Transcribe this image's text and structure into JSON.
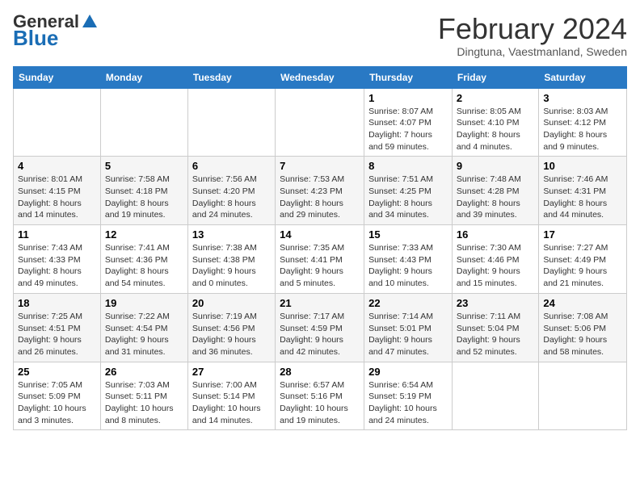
{
  "header": {
    "logo_general": "General",
    "logo_blue": "Blue",
    "title": "February 2024",
    "subtitle": "Dingtuna, Vaestmanland, Sweden"
  },
  "days": [
    "Sunday",
    "Monday",
    "Tuesday",
    "Wednesday",
    "Thursday",
    "Friday",
    "Saturday"
  ],
  "weeks": [
    [
      {
        "date": "",
        "text": ""
      },
      {
        "date": "",
        "text": ""
      },
      {
        "date": "",
        "text": ""
      },
      {
        "date": "",
        "text": ""
      },
      {
        "date": "1",
        "text": "Sunrise: 8:07 AM\nSunset: 4:07 PM\nDaylight: 7 hours\nand 59 minutes."
      },
      {
        "date": "2",
        "text": "Sunrise: 8:05 AM\nSunset: 4:10 PM\nDaylight: 8 hours\nand 4 minutes."
      },
      {
        "date": "3",
        "text": "Sunrise: 8:03 AM\nSunset: 4:12 PM\nDaylight: 8 hours\nand 9 minutes."
      }
    ],
    [
      {
        "date": "4",
        "text": "Sunrise: 8:01 AM\nSunset: 4:15 PM\nDaylight: 8 hours\nand 14 minutes."
      },
      {
        "date": "5",
        "text": "Sunrise: 7:58 AM\nSunset: 4:18 PM\nDaylight: 8 hours\nand 19 minutes."
      },
      {
        "date": "6",
        "text": "Sunrise: 7:56 AM\nSunset: 4:20 PM\nDaylight: 8 hours\nand 24 minutes."
      },
      {
        "date": "7",
        "text": "Sunrise: 7:53 AM\nSunset: 4:23 PM\nDaylight: 8 hours\nand 29 minutes."
      },
      {
        "date": "8",
        "text": "Sunrise: 7:51 AM\nSunset: 4:25 PM\nDaylight: 8 hours\nand 34 minutes."
      },
      {
        "date": "9",
        "text": "Sunrise: 7:48 AM\nSunset: 4:28 PM\nDaylight: 8 hours\nand 39 minutes."
      },
      {
        "date": "10",
        "text": "Sunrise: 7:46 AM\nSunset: 4:31 PM\nDaylight: 8 hours\nand 44 minutes."
      }
    ],
    [
      {
        "date": "11",
        "text": "Sunrise: 7:43 AM\nSunset: 4:33 PM\nDaylight: 8 hours\nand 49 minutes."
      },
      {
        "date": "12",
        "text": "Sunrise: 7:41 AM\nSunset: 4:36 PM\nDaylight: 8 hours\nand 54 minutes."
      },
      {
        "date": "13",
        "text": "Sunrise: 7:38 AM\nSunset: 4:38 PM\nDaylight: 9 hours\nand 0 minutes."
      },
      {
        "date": "14",
        "text": "Sunrise: 7:35 AM\nSunset: 4:41 PM\nDaylight: 9 hours\nand 5 minutes."
      },
      {
        "date": "15",
        "text": "Sunrise: 7:33 AM\nSunset: 4:43 PM\nDaylight: 9 hours\nand 10 minutes."
      },
      {
        "date": "16",
        "text": "Sunrise: 7:30 AM\nSunset: 4:46 PM\nDaylight: 9 hours\nand 15 minutes."
      },
      {
        "date": "17",
        "text": "Sunrise: 7:27 AM\nSunset: 4:49 PM\nDaylight: 9 hours\nand 21 minutes."
      }
    ],
    [
      {
        "date": "18",
        "text": "Sunrise: 7:25 AM\nSunset: 4:51 PM\nDaylight: 9 hours\nand 26 minutes."
      },
      {
        "date": "19",
        "text": "Sunrise: 7:22 AM\nSunset: 4:54 PM\nDaylight: 9 hours\nand 31 minutes."
      },
      {
        "date": "20",
        "text": "Sunrise: 7:19 AM\nSunset: 4:56 PM\nDaylight: 9 hours\nand 36 minutes."
      },
      {
        "date": "21",
        "text": "Sunrise: 7:17 AM\nSunset: 4:59 PM\nDaylight: 9 hours\nand 42 minutes."
      },
      {
        "date": "22",
        "text": "Sunrise: 7:14 AM\nSunset: 5:01 PM\nDaylight: 9 hours\nand 47 minutes."
      },
      {
        "date": "23",
        "text": "Sunrise: 7:11 AM\nSunset: 5:04 PM\nDaylight: 9 hours\nand 52 minutes."
      },
      {
        "date": "24",
        "text": "Sunrise: 7:08 AM\nSunset: 5:06 PM\nDaylight: 9 hours\nand 58 minutes."
      }
    ],
    [
      {
        "date": "25",
        "text": "Sunrise: 7:05 AM\nSunset: 5:09 PM\nDaylight: 10 hours\nand 3 minutes."
      },
      {
        "date": "26",
        "text": "Sunrise: 7:03 AM\nSunset: 5:11 PM\nDaylight: 10 hours\nand 8 minutes."
      },
      {
        "date": "27",
        "text": "Sunrise: 7:00 AM\nSunset: 5:14 PM\nDaylight: 10 hours\nand 14 minutes."
      },
      {
        "date": "28",
        "text": "Sunrise: 6:57 AM\nSunset: 5:16 PM\nDaylight: 10 hours\nand 19 minutes."
      },
      {
        "date": "29",
        "text": "Sunrise: 6:54 AM\nSunset: 5:19 PM\nDaylight: 10 hours\nand 24 minutes."
      },
      {
        "date": "",
        "text": ""
      },
      {
        "date": "",
        "text": ""
      }
    ]
  ]
}
